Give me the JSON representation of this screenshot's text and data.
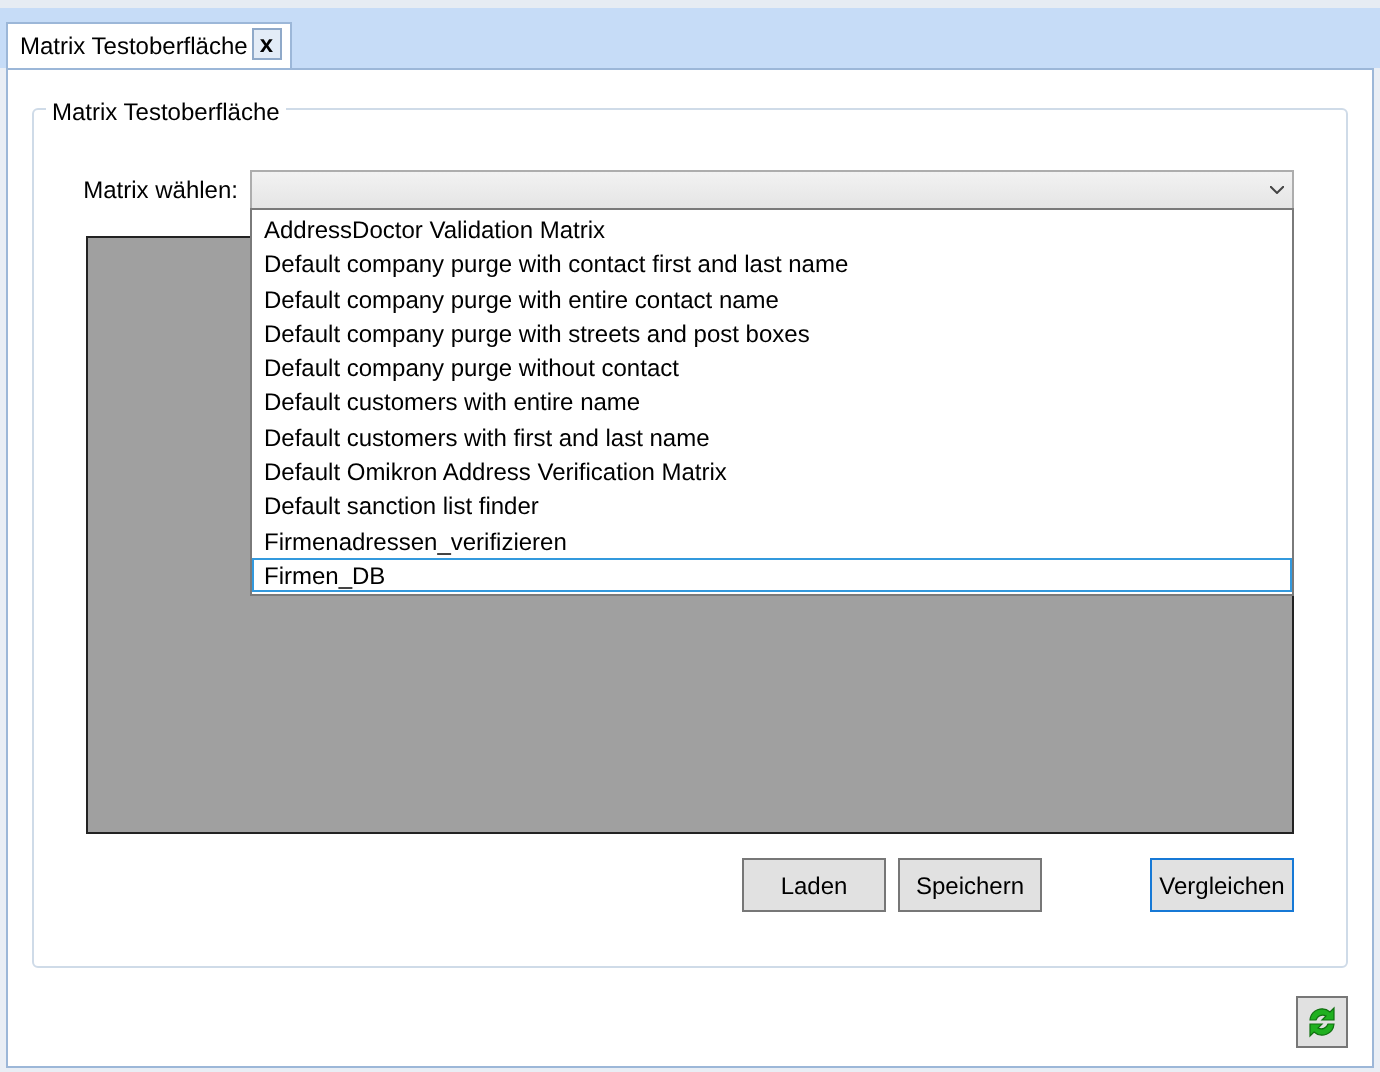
{
  "tabs": [
    {
      "label": "Matrix Testoberfläche",
      "selected": true,
      "close": "x"
    }
  ],
  "group_title": "Matrix Testoberfläche",
  "matrix_select": {
    "label": "Matrix wählen:",
    "expanded": true
  },
  "dropdown_items": [
    {
      "label": "AddressDoctor Validation Matrix",
      "selected": false
    },
    {
      "label": "Default company purge with contact first and last name",
      "selected": false
    },
    {
      "label": "Default company purge with entire contact name",
      "selected": false
    },
    {
      "label": "Default company purge with streets and post boxes",
      "selected": false
    },
    {
      "label": "Default company purge without contact",
      "selected": false
    },
    {
      "label": "Default customers with entire name",
      "selected": false
    },
    {
      "label": "Default customers with first and last name",
      "selected": false
    },
    {
      "label": "Default Omikron Address Verification Matrix",
      "selected": false
    },
    {
      "label": "Default sanction list finder",
      "selected": false
    },
    {
      "label": "Firmenadressen_verifizieren",
      "selected": false
    },
    {
      "label": "Firmen_DB",
      "selected": true
    }
  ],
  "buttons": [
    {
      "label": "Laden",
      "focused": false
    },
    {
      "label": "Speichern",
      "focused": false
    },
    {
      "label": "Vergleichen",
      "focused": true
    }
  ]
}
